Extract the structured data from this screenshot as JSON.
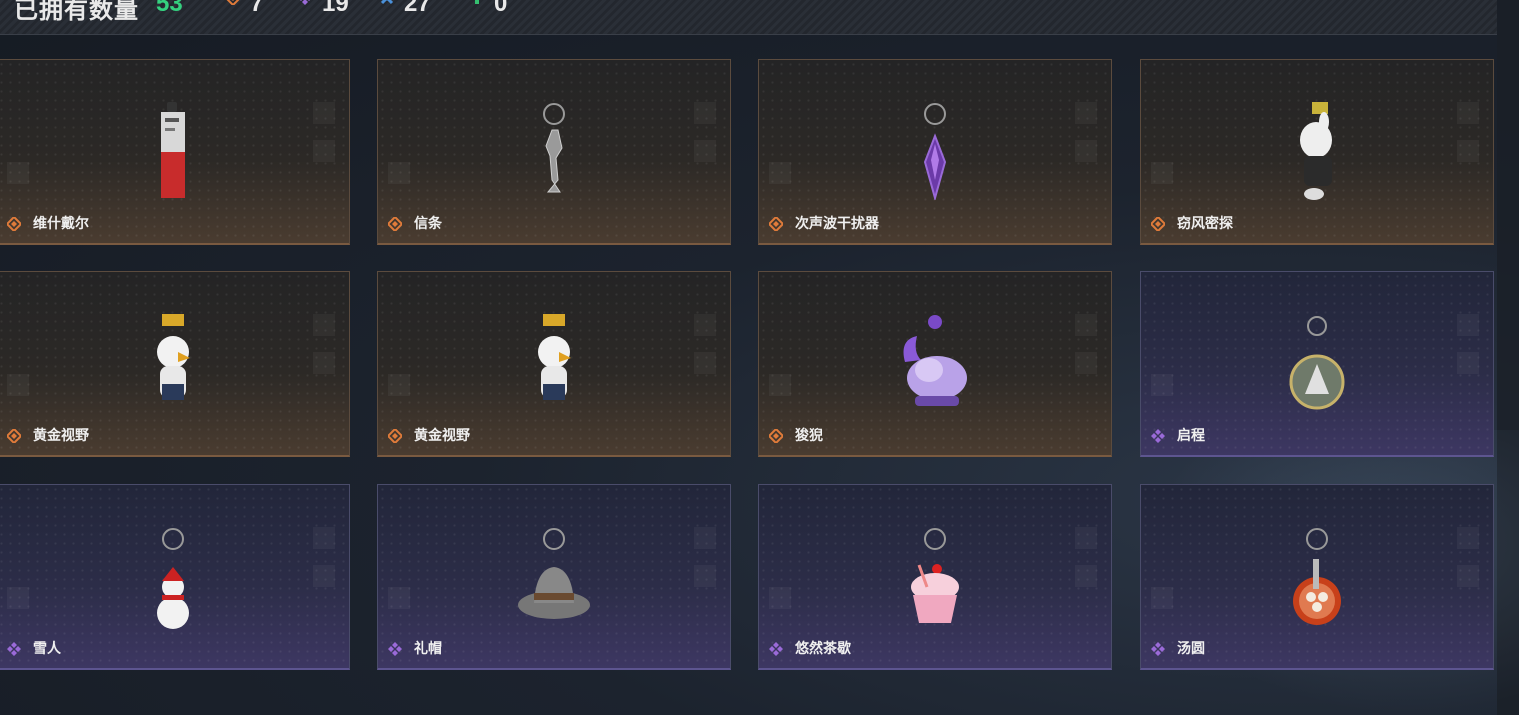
{
  "header": {
    "title": "已拥有数量",
    "owned_count": "53",
    "counters": [
      {
        "icon": "orange-rarity-icon",
        "value": "7",
        "color": "#e07b3a"
      },
      {
        "icon": "purple-rarity-icon",
        "value": "19",
        "color": "#9a6ad8"
      },
      {
        "icon": "blue-rarity-icon",
        "value": "27",
        "color": "#4a90d8"
      },
      {
        "icon": "green-rarity-icon",
        "value": "0",
        "color": "#35c070"
      }
    ]
  },
  "colors": {
    "orange_rarity": "#e07b3a",
    "purple_rarity": "#9a6ad8",
    "accent_green": "#35d07f"
  },
  "cards": [
    {
      "label": "维什戴尔",
      "rarity": "orange",
      "item_icon": "card-charm-icon"
    },
    {
      "label": "信条",
      "rarity": "orange",
      "item_icon": "wine-pitcher-charm-icon"
    },
    {
      "label": "次声波干扰器",
      "rarity": "orange",
      "item_icon": "purple-crystal-charm-icon"
    },
    {
      "label": "窃风密探",
      "rarity": "orange",
      "item_icon": "white-bunny-figure-icon"
    },
    {
      "label": "黄金视野",
      "rarity": "orange",
      "item_icon": "eagle-figure-icon"
    },
    {
      "label": "黄金视野",
      "rarity": "orange",
      "item_icon": "eagle-figure-icon"
    },
    {
      "label": "狻猊",
      "rarity": "orange",
      "item_icon": "purple-lion-figure-icon"
    },
    {
      "label": "启程",
      "rarity": "purple",
      "item_icon": "medal-badge-icon"
    },
    {
      "label": "雪人",
      "rarity": "purple",
      "item_icon": "snowman-charm-icon"
    },
    {
      "label": "礼帽",
      "rarity": "purple",
      "item_icon": "fedora-hat-icon"
    },
    {
      "label": "悠然茶歇",
      "rarity": "purple",
      "item_icon": "cupcake-charm-icon"
    },
    {
      "label": "汤圆",
      "rarity": "purple",
      "item_icon": "tangyuan-bowl-icon"
    }
  ]
}
